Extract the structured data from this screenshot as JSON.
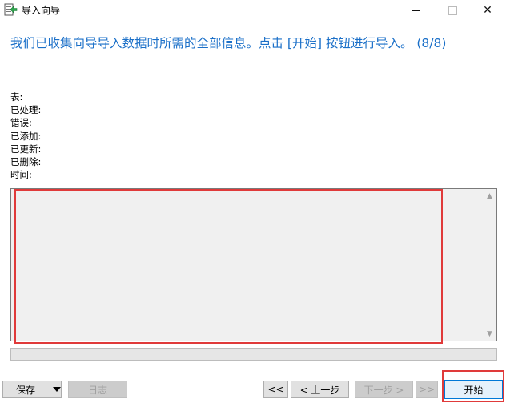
{
  "window": {
    "title": "导入向导",
    "controls": {
      "minimize": "minimize",
      "maximize": "maximize",
      "close": "✕"
    }
  },
  "headline": "我们已收集向导导入数据时所需的全部信息。点击 [开始] 按钮进行导入。 (8/8)",
  "stats": [
    {
      "label": "表:"
    },
    {
      "label": "已处理:"
    },
    {
      "label": "错误:"
    },
    {
      "label": "已添加:"
    },
    {
      "label": "已更新:"
    },
    {
      "label": "已删除:"
    },
    {
      "label": "时间:"
    }
  ],
  "log": {
    "text": ""
  },
  "progress": {
    "percent": 0
  },
  "footer": {
    "save_label": "保存",
    "log_label": "日志",
    "first_label": "<<",
    "prev_label": "< 上一步",
    "next_label": "下一步 >",
    "last_label": ">>",
    "start_label": "开始"
  },
  "colors": {
    "accent": "#1a6fc8",
    "highlight": "#e03a3a",
    "progress": "#06b025"
  },
  "icons": {
    "app": "import-wizard-icon",
    "dropdown": "chevron-down-icon"
  }
}
